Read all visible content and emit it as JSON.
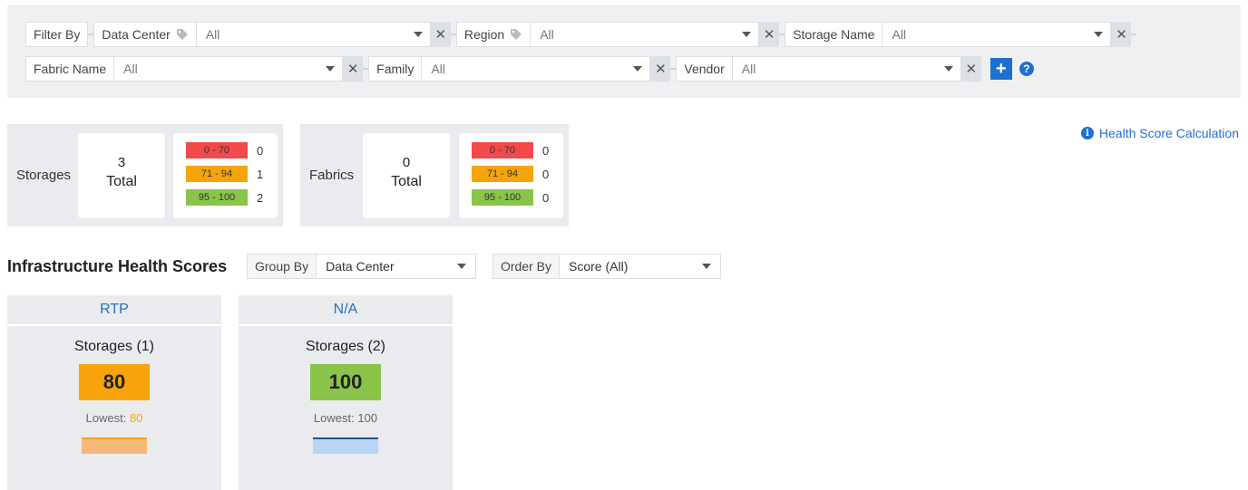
{
  "filters": {
    "filter_by_label": "Filter By",
    "row1": [
      {
        "label": "Data Center",
        "value": "All",
        "has_tag": true
      },
      {
        "label": "Region",
        "value": "All",
        "has_tag": true
      },
      {
        "label": "Storage Name",
        "value": "All",
        "has_tag": false
      }
    ],
    "row2": [
      {
        "label": "Fabric Name",
        "value": "All"
      },
      {
        "label": "Family",
        "value": "All"
      },
      {
        "label": "Vendor",
        "value": "All"
      }
    ],
    "add_label": "+",
    "help_label": "?"
  },
  "summary": {
    "storages": {
      "title": "Storages",
      "total": "3",
      "total_label": "Total",
      "ranges": [
        {
          "label": "0 - 70",
          "count": "0",
          "color": "#f04a4a"
        },
        {
          "label": "71 - 94",
          "count": "1",
          "color": "#f7a30a"
        },
        {
          "label": "95 - 100",
          "count": "2",
          "color": "#8ac44a"
        }
      ]
    },
    "fabrics": {
      "title": "Fabrics",
      "total": "0",
      "total_label": "Total",
      "ranges": [
        {
          "label": "0 - 70",
          "count": "0",
          "color": "#f04a4a"
        },
        {
          "label": "71 - 94",
          "count": "0",
          "color": "#f7a30a"
        },
        {
          "label": "95 - 100",
          "count": "0",
          "color": "#8ac44a"
        }
      ]
    }
  },
  "health_link": {
    "icon": "info-icon",
    "label": "Health Score Calculation"
  },
  "health": {
    "title": "Infrastructure Health Scores",
    "group_by_label": "Group By",
    "group_by_value": "Data Center",
    "order_by_label": "Order By",
    "order_by_value": "Score (All)"
  },
  "groups": [
    {
      "name": "RTP",
      "subtitle": "Storages (1)",
      "score": "80",
      "score_color": "#f7a30a",
      "lowest_label": "Lowest:",
      "lowest_value": "80",
      "lowest_color": "#f7a30a",
      "bar_color": "#f5b87a",
      "bar_line_color": "#f7a30a"
    },
    {
      "name": "N/A",
      "subtitle": "Storages (2)",
      "score": "100",
      "score_color": "#8ac44a",
      "lowest_label": "Lowest:",
      "lowest_value": "100",
      "lowest_color": "#666666",
      "bar_color": "#b9d5f3",
      "bar_line_color": "#1f4f9a"
    }
  ]
}
